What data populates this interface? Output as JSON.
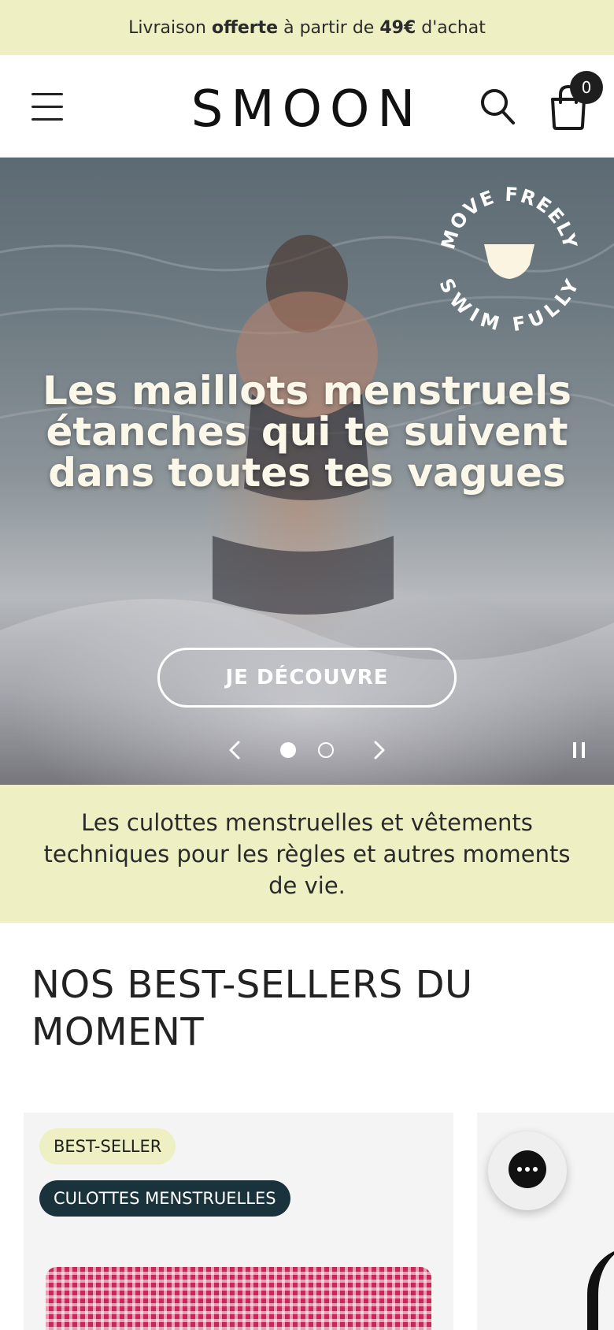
{
  "announcement": {
    "prefix": "Livraison ",
    "bold1": "offerte",
    "middle": " à partir de ",
    "bold2": "49€",
    "suffix": " d'achat"
  },
  "header": {
    "logo_text": "SMOON",
    "cart_count": "0",
    "icons": [
      "menu-icon",
      "search-icon",
      "bag-icon"
    ]
  },
  "hero": {
    "badge_top": "MOVE FREELY",
    "badge_bottom": "SWIM FULLY",
    "title": "Les maillots menstruels étanches qui te suivent dans toutes tes vagues",
    "cta": "JE DÉCOUVRE",
    "slides_total": 2,
    "active_slide": 1
  },
  "tagline": "Les culottes menstruelles et vêtements techniques pour les règles et autres moments de vie.",
  "bestsellers": {
    "title": "NOS BEST-SELLERS DU MOMENT",
    "cards": [
      {
        "badge": "BEST-SELLER",
        "category": "CULOTTES MENSTRUELLES"
      }
    ]
  },
  "colors": {
    "accent_yellow": "#eeefc2",
    "dark_teal": "#19323c",
    "product_pink": "#c8275a"
  }
}
